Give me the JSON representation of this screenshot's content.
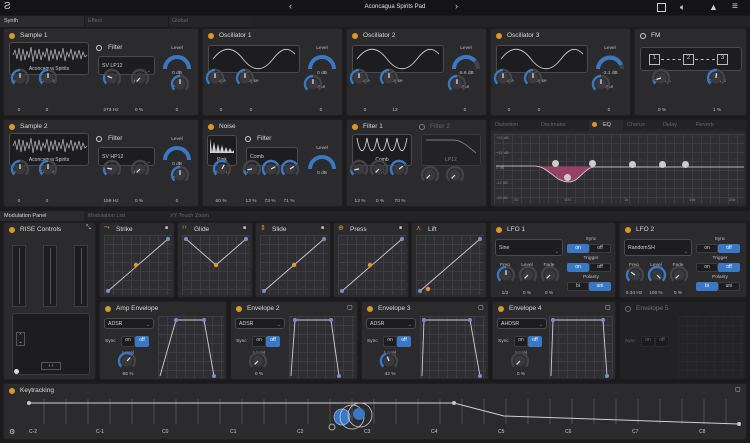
{
  "topbar": {
    "preset": "Aconcagua Spirits Pad",
    "prev": "‹",
    "next": "›"
  },
  "tabs_top": [
    "Synth",
    "Effect",
    "Global"
  ],
  "sample1": {
    "title": "Sample 1",
    "wave": "Aconcagua Spirits",
    "fine": {
      "label": "Fine",
      "value": "0"
    },
    "coarse": {
      "label": "Coarse",
      "value": "0"
    }
  },
  "filter1": {
    "title": "Filter",
    "type": "SV LP12",
    "cut": {
      "label": "Cut",
      "value": "273 Hz"
    },
    "res": {
      "label": "Res.",
      "value": "0 %"
    },
    "level": {
      "label": "Level",
      "value": "0 dB"
    },
    "pan": {
      "label": "Pan",
      "value": "0"
    }
  },
  "osc1": {
    "title": "Oscillator 1",
    "fine": {
      "label": "Fine",
      "value": "0"
    },
    "coarse": {
      "label": "Coarse",
      "value": "0"
    },
    "level": {
      "label": "Level",
      "value": "0 dB"
    },
    "pan": {
      "label": "Pan",
      "value": "0"
    }
  },
  "osc2": {
    "title": "Oscillator 2",
    "fine": {
      "label": "Fine",
      "value": "0"
    },
    "coarse": {
      "label": "Coarse",
      "value": "12"
    },
    "level": {
      "label": "Level",
      "value": "-5.6 dB"
    },
    "pan": {
      "label": "Pan",
      "value": "0"
    }
  },
  "osc3": {
    "title": "Oscillator 3",
    "fine": {
      "label": "Fine",
      "value": "0"
    },
    "coarse": {
      "label": "Coarse",
      "value": "0"
    },
    "level": {
      "label": "Level",
      "value": "-2.1 dB"
    },
    "pan": {
      "label": "Pan",
      "value": "0"
    }
  },
  "fm": {
    "title": "FM",
    "nodes": [
      "1",
      "2",
      "3"
    ],
    "depthA": {
      "label": "Depth A",
      "value": "0 %"
    },
    "depthB": {
      "label": "Depth B",
      "value": "1 %"
    }
  },
  "sample2": {
    "title": "Sample 2",
    "wave": "Aconcagua Spirits",
    "fine": {
      "label": "Fine",
      "value": "0"
    },
    "coarse": {
      "label": "Coarse",
      "value": "0"
    }
  },
  "filter2": {
    "title": "Filter",
    "type": "SV HP12",
    "cut": {
      "label": "Cut",
      "value": "159 Hz"
    },
    "res": {
      "label": "Res.",
      "value": "0 %"
    },
    "level": {
      "label": "Level",
      "value": "0 dB"
    },
    "pan": {
      "label": "Pan",
      "value": "0"
    }
  },
  "noise": {
    "title": "Noise",
    "color": "Pink",
    "filter_title": "Filter",
    "filter_type": "Comb",
    "width": {
      "label": "Width",
      "value": "60 %"
    },
    "del": {
      "label": "Del.",
      "value": "13 %"
    },
    "mix": {
      "label": "Mix",
      "value": "73 %"
    },
    "fb": {
      "label": "Fb.",
      "value": "71 %"
    },
    "level": {
      "label": "Level",
      "value": "0 dB"
    }
  },
  "filt1": {
    "title": "Filter 1",
    "type": "Comb",
    "del": {
      "label": "Del.",
      "value": "13 %"
    },
    "mix": {
      "label": "Mix",
      "value": "0 %"
    },
    "fb": {
      "label": "Fb.",
      "value": "70 %"
    }
  },
  "filt2": {
    "title": "Filter 2",
    "type": "LP12"
  },
  "fxtabs": [
    "Distortion",
    "Decimator",
    "EQ",
    "Chorus",
    "Delay",
    "Reverb"
  ],
  "eq": {
    "labels_left": [
      "+24 dB",
      "+12 dB",
      "0 dB",
      "-12 dB",
      "-24 dB"
    ],
    "labels_bottom": [
      "20",
      "100",
      "1k",
      "10k",
      "20k"
    ]
  },
  "modtabs": [
    "Modulation Panel",
    "Modulation List",
    "XY Touch Zoom"
  ],
  "rise": {
    "title": "RISE Controls"
  },
  "mpe": [
    {
      "title": "Strike"
    },
    {
      "title": "Glide"
    },
    {
      "title": "Slide"
    },
    {
      "title": "Press"
    },
    {
      "title": "Lift"
    }
  ],
  "lfo1": {
    "title": "LFO 1",
    "shape": "Sine",
    "sync": "Sync",
    "on": "on",
    "off": "off",
    "trigger": "Trigger",
    "polarity": "Polarity",
    "bi": "bi",
    "uni": "uni",
    "freq": {
      "label": "Freq",
      "value": "1/2"
    },
    "level": {
      "label": "Level",
      "value": "0 %"
    },
    "fade": {
      "label": "Fade",
      "value": "0 %"
    }
  },
  "lfo2": {
    "title": "LFO 2",
    "shape": "RandomSH",
    "sync": "Sync",
    "on": "on",
    "off": "off",
    "trigger": "Trigger",
    "polarity": "Polarity",
    "bi": "bi",
    "uni": "uni",
    "freq": {
      "label": "Freq",
      "value": "0.34 Hz"
    },
    "level": {
      "label": "Level",
      "value": "100 %"
    },
    "fade": {
      "label": "Fade",
      "value": "0 %"
    }
  },
  "env": [
    {
      "title": "Amp Envelope",
      "mode": "ADSR",
      "sync": "Sync",
      "on": "on",
      "off": "off",
      "level_label": "Level",
      "level": "66 %"
    },
    {
      "title": "Envelope 2",
      "mode": "ADSR",
      "sync": "Sync",
      "on": "on",
      "off": "off",
      "level_label": "Level",
      "level": "0 %"
    },
    {
      "title": "Envelope 3",
      "mode": "ADSR",
      "sync": "Sync",
      "on": "on",
      "off": "off",
      "level_label": "Level",
      "level": "42 %"
    },
    {
      "title": "Envelope 4",
      "mode": "AHDSR",
      "sync": "Sync",
      "on": "on",
      "off": "off",
      "level_label": "Level",
      "level": "0 %"
    },
    {
      "title": "Envelope 5",
      "mode": "",
      "sync": "Sync",
      "on": "on",
      "off": "off",
      "level_label": "",
      "level": ""
    }
  ],
  "keytracking": {
    "title": "Keytracking",
    "notes": [
      "C-2",
      "C-1",
      "C0",
      "C1",
      "C2",
      "C3",
      "C4",
      "C5",
      "C6",
      "C7",
      "C8"
    ]
  },
  "colors": {
    "accent": "#3b78c4",
    "orange": "#d99a2b",
    "eq_pink": "#b0456f"
  }
}
